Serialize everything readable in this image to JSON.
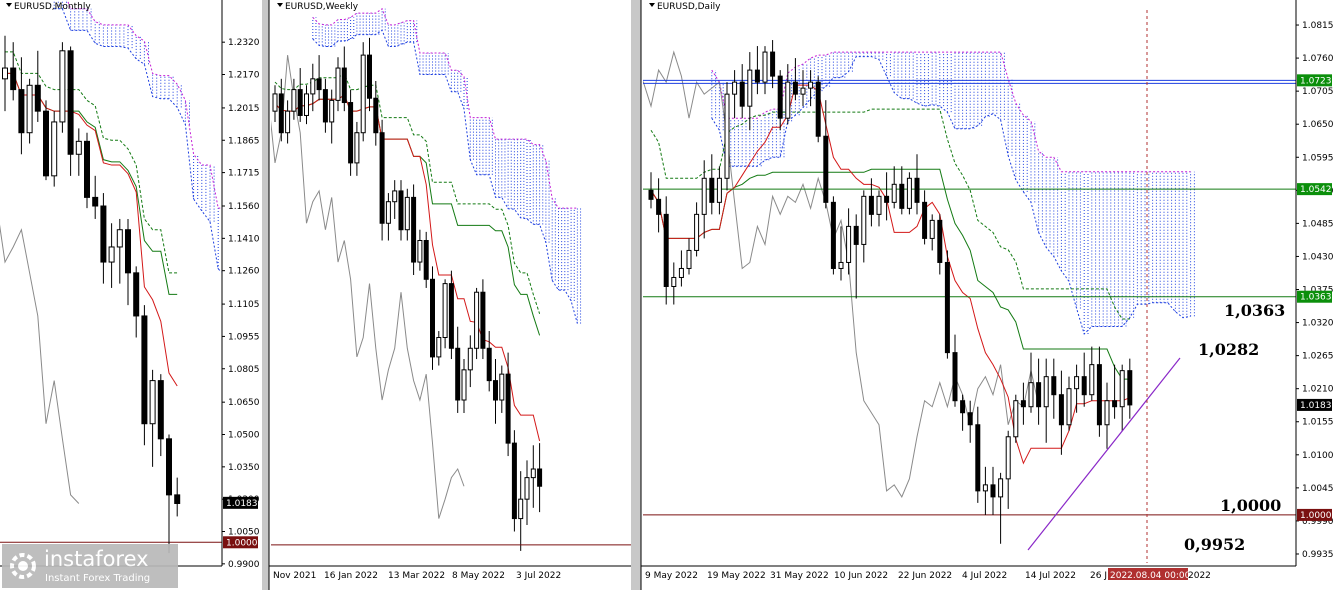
{
  "chart_data": [
    {
      "type": "candlestick",
      "title": "EURUSD,Monthly",
      "y_ticks": [
        "1.2320",
        "1.2170",
        "1.2015",
        "1.1865",
        "1.1715",
        "1.1560",
        "1.1410",
        "1.1260",
        "1.1105",
        "1.0955",
        "1.0805",
        "1.0650",
        "1.0500",
        "1.0350",
        "1.0200",
        "1.0050",
        "0.9900"
      ],
      "ylim": [
        0.989,
        1.246
      ],
      "price_label": "1.0183",
      "level_label": "1.0000",
      "levels": [
        1.0
      ],
      "current_price": 1.0183,
      "x_labels": [],
      "candles": [
        [
          1.215,
          1.235,
          1.2,
          1.22
        ],
        [
          1.22,
          1.232,
          1.205,
          1.21
        ],
        [
          1.21,
          1.225,
          1.18,
          1.19
        ],
        [
          1.19,
          1.215,
          1.185,
          1.212
        ],
        [
          1.212,
          1.228,
          1.195,
          1.2
        ],
        [
          1.2,
          1.205,
          1.168,
          1.17
        ],
        [
          1.17,
          1.2,
          1.165,
          1.195
        ],
        [
          1.195,
          1.232,
          1.19,
          1.228
        ],
        [
          1.228,
          1.23,
          1.17,
          1.18
        ],
        [
          1.18,
          1.192,
          1.17,
          1.186
        ],
        [
          1.186,
          1.19,
          1.155,
          1.16
        ],
        [
          1.16,
          1.17,
          1.15,
          1.156
        ],
        [
          1.156,
          1.162,
          1.12,
          1.13
        ],
        [
          1.13,
          1.148,
          1.118,
          1.137
        ],
        [
          1.137,
          1.15,
          1.12,
          1.145
        ],
        [
          1.145,
          1.15,
          1.11,
          1.125
        ],
        [
          1.125,
          1.128,
          1.095,
          1.105
        ],
        [
          1.105,
          1.11,
          1.045,
          1.055
        ],
        [
          1.055,
          1.08,
          1.035,
          1.075
        ],
        [
          1.075,
          1.078,
          1.04,
          1.048
        ],
        [
          1.048,
          1.05,
          0.995,
          1.022
        ],
        [
          1.022,
          1.03,
          1.012,
          1.018
        ]
      ]
    },
    {
      "type": "candlestick",
      "title": "EURUSD,Weekly",
      "x_labels": [
        "Nov 2021",
        "16 Jan 2022",
        "13 Mar 2022",
        "8 May 2022",
        "3 Jul 2022"
      ],
      "ylim": [
        0.989,
        1.246
      ],
      "candles": [
        [
          1.2,
          1.212,
          1.195,
          1.208
        ],
        [
          1.208,
          1.215,
          1.186,
          1.19
        ],
        [
          1.19,
          1.205,
          1.185,
          1.2
        ],
        [
          1.2,
          1.215,
          1.196,
          1.21
        ],
        [
          1.21,
          1.22,
          1.195,
          1.198
        ],
        [
          1.198,
          1.212,
          1.194,
          1.208
        ],
        [
          1.208,
          1.222,
          1.2,
          1.215
        ],
        [
          1.215,
          1.226,
          1.205,
          1.21
        ],
        [
          1.21,
          1.215,
          1.19,
          1.195
        ],
        [
          1.195,
          1.21,
          1.185,
          1.205
        ],
        [
          1.205,
          1.225,
          1.2,
          1.22
        ],
        [
          1.22,
          1.23,
          1.2,
          1.204
        ],
        [
          1.204,
          1.21,
          1.17,
          1.176
        ],
        [
          1.176,
          1.195,
          1.17,
          1.19
        ],
        [
          1.19,
          1.232,
          1.186,
          1.226
        ],
        [
          1.226,
          1.234,
          1.2,
          1.206
        ],
        [
          1.206,
          1.214,
          1.184,
          1.19
        ],
        [
          1.19,
          1.196,
          1.14,
          1.148
        ],
        [
          1.148,
          1.162,
          1.14,
          1.158
        ],
        [
          1.158,
          1.168,
          1.15,
          1.163
        ],
        [
          1.163,
          1.168,
          1.14,
          1.145
        ],
        [
          1.145,
          1.164,
          1.14,
          1.16
        ],
        [
          1.16,
          1.166,
          1.124,
          1.13
        ],
        [
          1.13,
          1.145,
          1.126,
          1.14
        ],
        [
          1.14,
          1.144,
          1.118,
          1.122
        ],
        [
          1.122,
          1.128,
          1.08,
          1.086
        ],
        [
          1.086,
          1.098,
          1.082,
          1.095
        ],
        [
          1.095,
          1.122,
          1.09,
          1.12
        ],
        [
          1.12,
          1.126,
          1.085,
          1.09
        ],
        [
          1.09,
          1.1,
          1.06,
          1.066
        ],
        [
          1.066,
          1.085,
          1.06,
          1.08
        ],
        [
          1.08,
          1.096,
          1.072,
          1.09
        ],
        [
          1.09,
          1.118,
          1.085,
          1.116
        ],
        [
          1.116,
          1.122,
          1.085,
          1.09
        ],
        [
          1.09,
          1.098,
          1.07,
          1.075
        ],
        [
          1.075,
          1.085,
          1.055,
          1.066
        ],
        [
          1.066,
          1.082,
          1.06,
          1.078
        ],
        [
          1.078,
          1.088,
          1.04,
          1.046
        ],
        [
          1.046,
          1.052,
          1.005,
          1.011
        ],
        [
          1.011,
          1.033,
          0.996,
          1.02
        ],
        [
          1.02,
          1.038,
          1.008,
          1.03
        ],
        [
          1.03,
          1.045,
          1.016,
          1.034
        ],
        [
          1.034,
          1.046,
          1.014,
          1.026
        ]
      ]
    },
    {
      "type": "candlestick",
      "title": "EURUSD,Daily",
      "y_ticks": [
        "1.0815",
        "1.0760",
        "1.0705",
        "1.0650",
        "1.0595",
        "1.0540",
        "1.0485",
        "1.0430",
        "1.0375",
        "1.0320",
        "1.0265",
        "1.0210",
        "1.0155",
        "1.0100",
        "1.0045",
        "0.9990",
        "0.9935"
      ],
      "ylim": [
        0.992,
        1.084
      ],
      "x_labels": [
        "9 May 2022",
        "19 May 2022",
        "31 May 2022",
        "10 Jun 2022",
        "22 Jun 2022",
        "4 Jul 2022",
        "14 Jul 2022",
        "26 J",
        "2022.08.04 00:00",
        "2022"
      ],
      "price_label": "1.0183",
      "level_labels": [
        "1.0723",
        "1.0542",
        "1.0363",
        "1.0000"
      ],
      "levels": [
        1.0723,
        1.0542,
        1.0363,
        1.0
      ],
      "current_price": 1.0183,
      "annotations": [
        "1,0363",
        "1,0282",
        "1,0000",
        "0,9952"
      ],
      "candles": [
        [
          1.054,
          1.057,
          1.051,
          1.0525
        ],
        [
          1.0525,
          1.056,
          1.047,
          1.05
        ],
        [
          1.05,
          1.053,
          1.035,
          1.038
        ],
        [
          1.038,
          1.042,
          1.035,
          1.0395
        ],
        [
          1.0395,
          1.044,
          1.038,
          1.041
        ],
        [
          1.041,
          1.046,
          1.04,
          1.044
        ],
        [
          1.044,
          1.052,
          1.043,
          1.05
        ],
        [
          1.05,
          1.059,
          1.046,
          1.056
        ],
        [
          1.056,
          1.06,
          1.05,
          1.052
        ],
        [
          1.052,
          1.058,
          1.05,
          1.056
        ],
        [
          1.056,
          1.072,
          1.054,
          1.07
        ],
        [
          1.07,
          1.074,
          1.066,
          1.072
        ],
        [
          1.072,
          1.075,
          1.066,
          1.068
        ],
        [
          1.068,
          1.077,
          1.064,
          1.074
        ],
        [
          1.074,
          1.078,
          1.07,
          1.072
        ],
        [
          1.072,
          1.078,
          1.07,
          1.077
        ],
        [
          1.077,
          1.079,
          1.071,
          1.073
        ],
        [
          1.073,
          1.074,
          1.064,
          1.066
        ],
        [
          1.066,
          1.075,
          1.065,
          1.072
        ],
        [
          1.072,
          1.076,
          1.069,
          1.07
        ],
        [
          1.07,
          1.074,
          1.068,
          1.071
        ],
        [
          1.071,
          1.074,
          1.068,
          1.072
        ],
        [
          1.072,
          1.073,
          1.062,
          1.063
        ],
        [
          1.063,
          1.069,
          1.051,
          1.052
        ],
        [
          1.052,
          1.053,
          1.04,
          1.041
        ],
        [
          1.041,
          1.048,
          1.039,
          1.042
        ],
        [
          1.042,
          1.051,
          1.04,
          1.048
        ],
        [
          1.048,
          1.05,
          1.036,
          1.045
        ],
        [
          1.045,
          1.054,
          1.042,
          1.053
        ],
        [
          1.053,
          1.056,
          1.048,
          1.05
        ],
        [
          1.05,
          1.054,
          1.048,
          1.053
        ],
        [
          1.053,
          1.057,
          1.049,
          1.052
        ],
        [
          1.052,
          1.058,
          1.051,
          1.055
        ],
        [
          1.055,
          1.058,
          1.05,
          1.051
        ],
        [
          1.051,
          1.057,
          1.05,
          1.056
        ],
        [
          1.056,
          1.06,
          1.05,
          1.052
        ],
        [
          1.052,
          1.054,
          1.045,
          1.046
        ],
        [
          1.046,
          1.05,
          1.044,
          1.049
        ],
        [
          1.049,
          1.05,
          1.04,
          1.042
        ],
        [
          1.042,
          1.044,
          1.026,
          1.027
        ],
        [
          1.027,
          1.03,
          1.018,
          1.019
        ],
        [
          1.019,
          1.02,
          1.014,
          1.017
        ],
        [
          1.017,
          1.019,
          1.012,
          1.015
        ],
        [
          1.015,
          1.018,
          1.002,
          1.004
        ],
        [
          1.004,
          1.008,
          1.0,
          1.005
        ],
        [
          1.005,
          1.008,
          1.0,
          1.003
        ],
        [
          1.003,
          1.007,
          0.9952,
          1.006
        ],
        [
          1.006,
          1.014,
          1.001,
          1.013
        ],
        [
          1.013,
          1.02,
          1.012,
          1.019
        ],
        [
          1.019,
          1.022,
          1.015,
          1.018
        ],
        [
          1.018,
          1.027,
          1.017,
          1.022
        ],
        [
          1.022,
          1.026,
          1.015,
          1.018
        ],
        [
          1.018,
          1.026,
          1.012,
          1.023
        ],
        [
          1.023,
          1.026,
          1.016,
          1.02
        ],
        [
          1.02,
          1.024,
          1.01,
          1.015
        ],
        [
          1.015,
          1.023,
          1.014,
          1.021
        ],
        [
          1.021,
          1.025,
          1.017,
          1.023
        ],
        [
          1.023,
          1.027,
          1.018,
          1.02
        ],
        [
          1.02,
          1.028,
          1.019,
          1.025
        ],
        [
          1.025,
          1.028,
          1.013,
          1.015
        ],
        [
          1.015,
          1.022,
          1.011,
          1.019
        ],
        [
          1.019,
          1.025,
          1.016,
          1.018
        ],
        [
          1.018,
          1.025,
          1.014,
          1.024
        ],
        [
          1.024,
          1.026,
          1.016,
          1.0183
        ]
      ]
    }
  ],
  "watermark": {
    "brand": "instaforex",
    "tagline": "Instant Forex Trading"
  }
}
